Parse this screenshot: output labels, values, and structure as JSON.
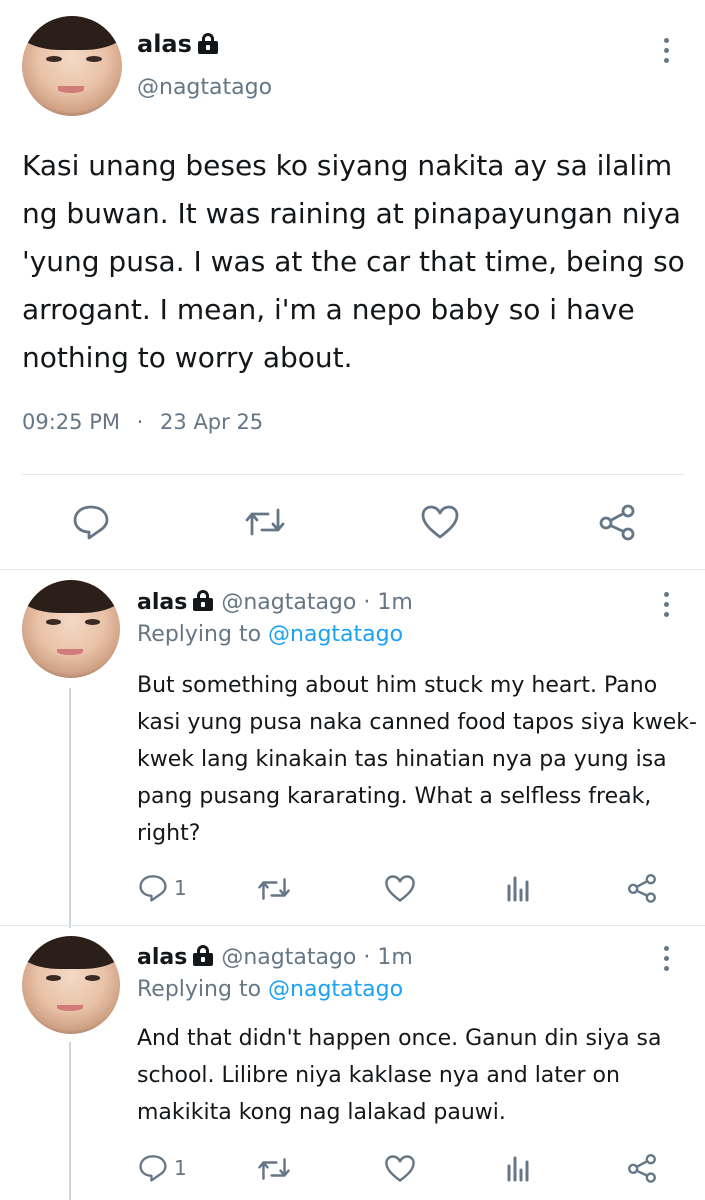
{
  "main_tweet": {
    "author_name": "alas",
    "author_handle": "@nagtatago",
    "text": "Kasi unang beses ko siyang nakita ay sa ilalim ng buwan. It was raining at pinapayungan niya 'yung pusa. I was at the car that time, being so arrogant. I mean, i'm a nepo baby so i have nothing to worry about.",
    "time": "09:25 PM",
    "separator": "·",
    "date": "23 Apr 25",
    "actions": [
      "reply-icon",
      "retweet-icon",
      "like-icon",
      "share-icon"
    ]
  },
  "replies": [
    {
      "author_name": "alas",
      "author_handle": "@nagtatago",
      "age": "· 1m",
      "replying_label": "Replying to",
      "replying_handle": "@nagtatago",
      "text": "But something about him stuck my heart. Pano kasi yung pusa naka canned food tapos siya kwek-kwek lang kinakain tas hinatian nya pa yung isa pang pusang kararating. What a selfless freak, right?",
      "reply_count": "1"
    },
    {
      "author_name": "alas",
      "author_handle": "@nagtatago",
      "age": "· 1m",
      "replying_label": "Replying to",
      "replying_handle": "@nagtatago",
      "text": "And that didn't happen once. Ganun din siya sa school. Lilibre niya kaklase nya and later on makikita kong nag lalakad pauwi.",
      "reply_count": "1"
    }
  ],
  "colors": {
    "text": "#14171a",
    "muted": "#657786",
    "link": "#1da1f2",
    "divider": "#e1e8ed"
  }
}
